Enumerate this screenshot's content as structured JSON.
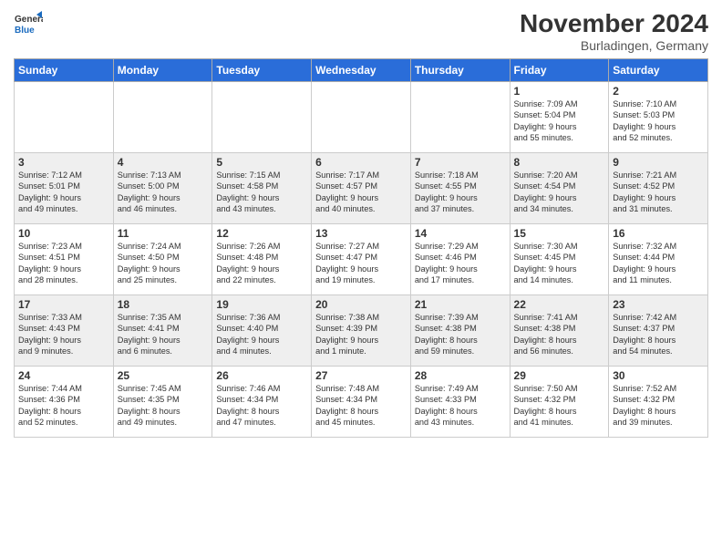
{
  "header": {
    "logo_line1": "General",
    "logo_line2": "Blue",
    "month_title": "November 2024",
    "location": "Burladingen, Germany"
  },
  "weekdays": [
    "Sunday",
    "Monday",
    "Tuesday",
    "Wednesday",
    "Thursday",
    "Friday",
    "Saturday"
  ],
  "weeks": [
    [
      {
        "day": "",
        "info": ""
      },
      {
        "day": "",
        "info": ""
      },
      {
        "day": "",
        "info": ""
      },
      {
        "day": "",
        "info": ""
      },
      {
        "day": "",
        "info": ""
      },
      {
        "day": "1",
        "info": "Sunrise: 7:09 AM\nSunset: 5:04 PM\nDaylight: 9 hours\nand 55 minutes."
      },
      {
        "day": "2",
        "info": "Sunrise: 7:10 AM\nSunset: 5:03 PM\nDaylight: 9 hours\nand 52 minutes."
      }
    ],
    [
      {
        "day": "3",
        "info": "Sunrise: 7:12 AM\nSunset: 5:01 PM\nDaylight: 9 hours\nand 49 minutes."
      },
      {
        "day": "4",
        "info": "Sunrise: 7:13 AM\nSunset: 5:00 PM\nDaylight: 9 hours\nand 46 minutes."
      },
      {
        "day": "5",
        "info": "Sunrise: 7:15 AM\nSunset: 4:58 PM\nDaylight: 9 hours\nand 43 minutes."
      },
      {
        "day": "6",
        "info": "Sunrise: 7:17 AM\nSunset: 4:57 PM\nDaylight: 9 hours\nand 40 minutes."
      },
      {
        "day": "7",
        "info": "Sunrise: 7:18 AM\nSunset: 4:55 PM\nDaylight: 9 hours\nand 37 minutes."
      },
      {
        "day": "8",
        "info": "Sunrise: 7:20 AM\nSunset: 4:54 PM\nDaylight: 9 hours\nand 34 minutes."
      },
      {
        "day": "9",
        "info": "Sunrise: 7:21 AM\nSunset: 4:52 PM\nDaylight: 9 hours\nand 31 minutes."
      }
    ],
    [
      {
        "day": "10",
        "info": "Sunrise: 7:23 AM\nSunset: 4:51 PM\nDaylight: 9 hours\nand 28 minutes."
      },
      {
        "day": "11",
        "info": "Sunrise: 7:24 AM\nSunset: 4:50 PM\nDaylight: 9 hours\nand 25 minutes."
      },
      {
        "day": "12",
        "info": "Sunrise: 7:26 AM\nSunset: 4:48 PM\nDaylight: 9 hours\nand 22 minutes."
      },
      {
        "day": "13",
        "info": "Sunrise: 7:27 AM\nSunset: 4:47 PM\nDaylight: 9 hours\nand 19 minutes."
      },
      {
        "day": "14",
        "info": "Sunrise: 7:29 AM\nSunset: 4:46 PM\nDaylight: 9 hours\nand 17 minutes."
      },
      {
        "day": "15",
        "info": "Sunrise: 7:30 AM\nSunset: 4:45 PM\nDaylight: 9 hours\nand 14 minutes."
      },
      {
        "day": "16",
        "info": "Sunrise: 7:32 AM\nSunset: 4:44 PM\nDaylight: 9 hours\nand 11 minutes."
      }
    ],
    [
      {
        "day": "17",
        "info": "Sunrise: 7:33 AM\nSunset: 4:43 PM\nDaylight: 9 hours\nand 9 minutes."
      },
      {
        "day": "18",
        "info": "Sunrise: 7:35 AM\nSunset: 4:41 PM\nDaylight: 9 hours\nand 6 minutes."
      },
      {
        "day": "19",
        "info": "Sunrise: 7:36 AM\nSunset: 4:40 PM\nDaylight: 9 hours\nand 4 minutes."
      },
      {
        "day": "20",
        "info": "Sunrise: 7:38 AM\nSunset: 4:39 PM\nDaylight: 9 hours\nand 1 minute."
      },
      {
        "day": "21",
        "info": "Sunrise: 7:39 AM\nSunset: 4:38 PM\nDaylight: 8 hours\nand 59 minutes."
      },
      {
        "day": "22",
        "info": "Sunrise: 7:41 AM\nSunset: 4:38 PM\nDaylight: 8 hours\nand 56 minutes."
      },
      {
        "day": "23",
        "info": "Sunrise: 7:42 AM\nSunset: 4:37 PM\nDaylight: 8 hours\nand 54 minutes."
      }
    ],
    [
      {
        "day": "24",
        "info": "Sunrise: 7:44 AM\nSunset: 4:36 PM\nDaylight: 8 hours\nand 52 minutes."
      },
      {
        "day": "25",
        "info": "Sunrise: 7:45 AM\nSunset: 4:35 PM\nDaylight: 8 hours\nand 49 minutes."
      },
      {
        "day": "26",
        "info": "Sunrise: 7:46 AM\nSunset: 4:34 PM\nDaylight: 8 hours\nand 47 minutes."
      },
      {
        "day": "27",
        "info": "Sunrise: 7:48 AM\nSunset: 4:34 PM\nDaylight: 8 hours\nand 45 minutes."
      },
      {
        "day": "28",
        "info": "Sunrise: 7:49 AM\nSunset: 4:33 PM\nDaylight: 8 hours\nand 43 minutes."
      },
      {
        "day": "29",
        "info": "Sunrise: 7:50 AM\nSunset: 4:32 PM\nDaylight: 8 hours\nand 41 minutes."
      },
      {
        "day": "30",
        "info": "Sunrise: 7:52 AM\nSunset: 4:32 PM\nDaylight: 8 hours\nand 39 minutes."
      }
    ]
  ]
}
